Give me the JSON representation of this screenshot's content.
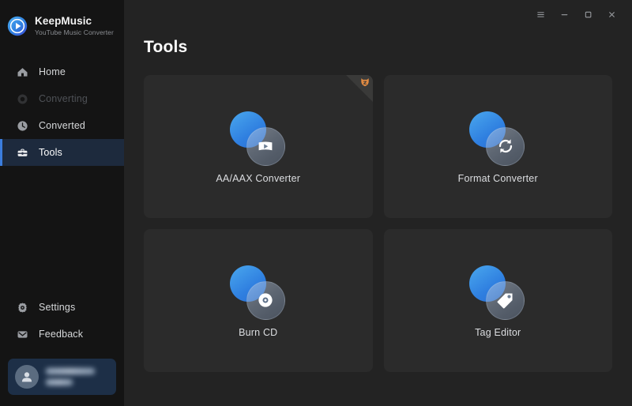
{
  "brand": {
    "logo_icon": "play-circle-logo-icon",
    "title": "KeepMusic",
    "subtitle": "YouTube Music Converter"
  },
  "sidebar": {
    "items": [
      {
        "label": "Home",
        "icon": "home-icon",
        "state": "normal"
      },
      {
        "label": "Converting",
        "icon": "converting-icon",
        "state": "disabled"
      },
      {
        "label": "Converted",
        "icon": "clock-icon",
        "state": "normal"
      },
      {
        "label": "Tools",
        "icon": "toolbox-icon",
        "state": "active"
      }
    ],
    "bottom_items": [
      {
        "label": "Settings",
        "icon": "gear-icon"
      },
      {
        "label": "Feedback",
        "icon": "envelope-icon"
      }
    ],
    "account": {
      "avatar_icon": "user-avatar-icon",
      "name_redacted": "",
      "status_redacted": ""
    }
  },
  "titlebar": {
    "buttons": [
      {
        "name": "menu",
        "icon": "hamburger-menu-icon"
      },
      {
        "name": "minimize",
        "icon": "minimize-icon"
      },
      {
        "name": "maximize",
        "icon": "maximize-icon"
      },
      {
        "name": "close",
        "icon": "close-icon"
      }
    ]
  },
  "main": {
    "page_title": "Tools",
    "cards": [
      {
        "label": "AA/AAX Converter",
        "icon": "video-play-icon",
        "badge": "fox-corner-badge"
      },
      {
        "label": "Format Converter",
        "icon": "refresh-sync-icon",
        "badge": null
      },
      {
        "label": "Burn CD",
        "icon": "cd-disc-icon",
        "badge": null
      },
      {
        "label": "Tag Editor",
        "icon": "tag-label-icon",
        "badge": null
      }
    ]
  },
  "colors": {
    "sidebar_bg": "#141414",
    "content_bg": "#232323",
    "card_bg": "#2b2b2b",
    "accent_blue": "#3b7ddd",
    "active_row_bg": "#1d2a3d",
    "account_bg": "#1d2f47",
    "badge_orange": "#e08a42"
  }
}
